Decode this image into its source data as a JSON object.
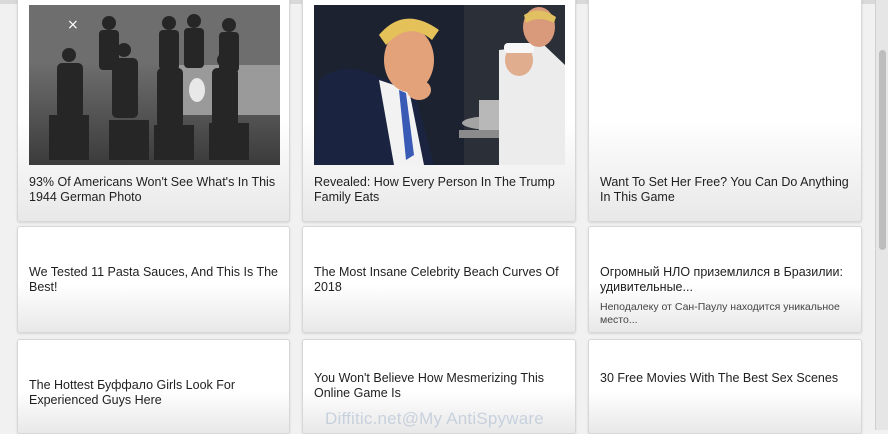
{
  "cards": [
    {
      "headline": "93% Of Americans Won't See What's In This 1944 German Photo",
      "image": "vintage-soldiers-photo"
    },
    {
      "headline": "Revealed: How Every Person In The Trump Family Eats",
      "image": "man-eating-with-chef-photo"
    },
    {
      "headline": "Want To Set Her Free? You Can Do Anything In This Game"
    },
    {
      "headline": "We Tested 11 Pasta Sauces, And This Is The Best!"
    },
    {
      "headline": "The Most Insane Celebrity Beach Curves Of 2018"
    },
    {
      "headline": "Огромный НЛО приземлился в Бразилии: удивительные...",
      "description": "Неподалеку от Сан-Паулу находится уникальное место..."
    },
    {
      "headline": "The Hottest Буффало Girls Look For Experienced Guys Here"
    },
    {
      "headline": "You Won't Believe How Mesmerizing This Online Game Is"
    },
    {
      "headline": "30 Free Movies With The Best Sex Scenes"
    }
  ],
  "watermark": "Diffitic.net@My AntiSpyware"
}
